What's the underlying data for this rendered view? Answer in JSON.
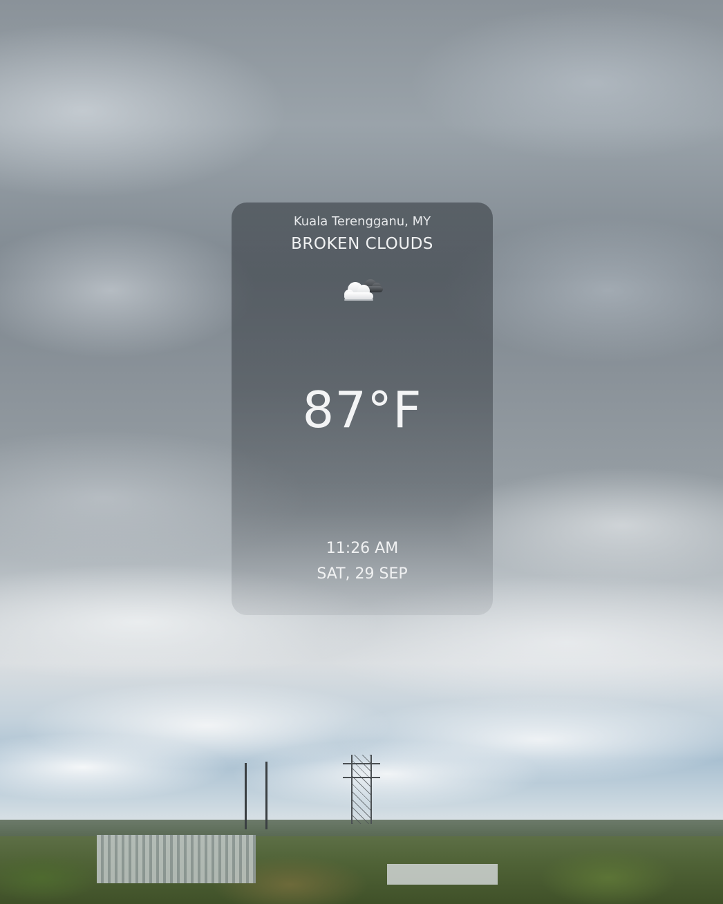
{
  "weather": {
    "location": "Kuala Terengganu, MY",
    "condition": "BROKEN CLOUDS",
    "icon": "broken-clouds-icon",
    "temperature": "87°F",
    "time": "11:26 AM",
    "date": "SAT, 29 SEP"
  }
}
